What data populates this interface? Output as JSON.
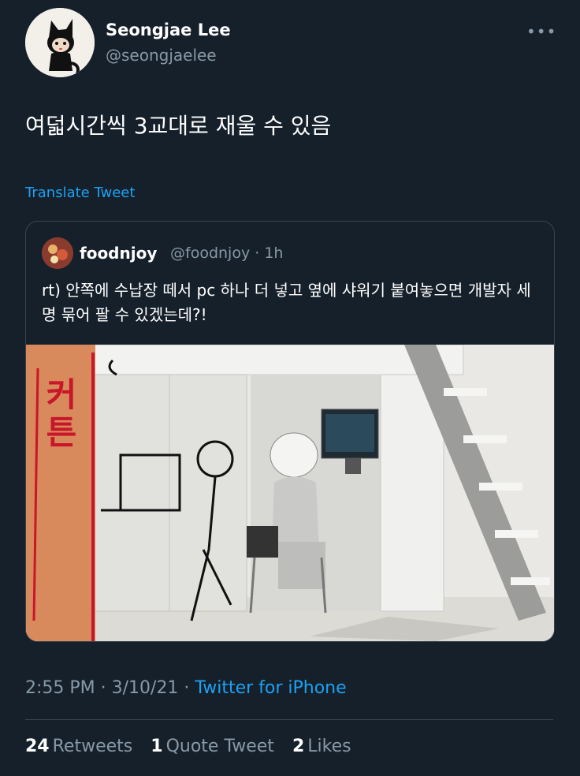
{
  "tweet": {
    "author": {
      "name": "Seongjae Lee",
      "handle": "@seongjaelee"
    },
    "more_icon": "more-horizontal-icon",
    "more_glyph": "•••",
    "text": "여덟시간씩 3교대로 재울 수 있음",
    "translate_label": "Translate Tweet",
    "quote": {
      "author": {
        "name": "foodnjoy",
        "handle": "@foodnjoy",
        "time": "1h"
      },
      "meta_separator": " · ",
      "text": "rt) 안쪽에 수납장 떼서 pc 하나 더 넣고 옆에 샤워기 붙여놓으면 개발자 세 명 묶어 팔 수 있겠는데?!",
      "image": {
        "description_icon": "loft-bed-photo",
        "handwritten_text": [
          "커",
          "튼"
        ]
      }
    },
    "timestamp": "2:55 PM · 3/10/21 · ",
    "client": "Twitter for iPhone",
    "stats": {
      "retweets": {
        "count": "24",
        "label": "Retweets"
      },
      "quote_tweets": {
        "count": "1",
        "label": "Quote Tweet"
      },
      "likes": {
        "count": "2",
        "label": "Likes"
      }
    }
  },
  "colors": {
    "background": "#15202b",
    "accent": "#1da1f2",
    "secondary_text": "#8899a6",
    "border": "#38444d"
  }
}
